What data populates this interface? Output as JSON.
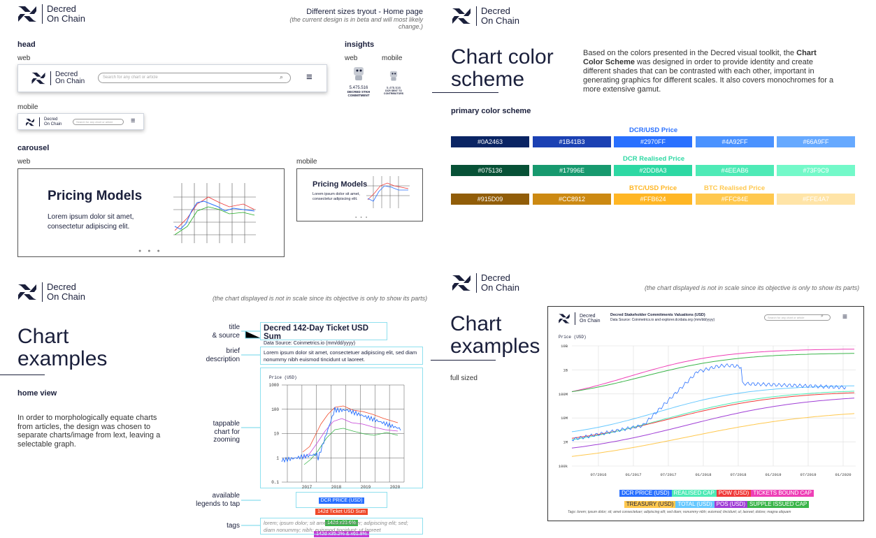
{
  "logo": {
    "line1": "Decred",
    "line2": "On Chain"
  },
  "page_title": "Different sizes tryout  - Home page",
  "page_subtitle": "(the current design is in beta and will most likely change.)",
  "head": {
    "label": "head",
    "web": "web",
    "mobile": "mobile",
    "search_placeholder": "Search for any chart or article"
  },
  "insights": {
    "label": "insights",
    "web": "web",
    "mobile": "mobile",
    "web_value": "5.475.516",
    "web_caption": "DECRED STKH COMMITMENT",
    "mobile_value": "5.475.516",
    "mobile_caption": "DCR SENT TO CONTRIBUTORS"
  },
  "carousel": {
    "label": "carousel",
    "web": "web",
    "mobile": "mobile",
    "title": "Pricing Models",
    "body": "Lorem ipsum dolor sit amet, consectetur adipiscing elit.",
    "title_m": "Pricing Models",
    "body_m": "Lorem ipsum dolor sit amet, consectetur adipiscing elit."
  },
  "color": {
    "title1": "Chart color",
    "title2": "scheme",
    "desc_pre": "Based on the colors presented in the Decred visual toolkit, the ",
    "desc_bold": "Chart Color Scheme",
    "desc_post": " was designed in order to provide identity and create different shades that can be contrasted with each other, important in generating graphics for different scales. It also covers monochromes for a more extensive gamut.",
    "primary": "primary color scheme",
    "labels": {
      "dcrusd": "DCR/USD Price",
      "realised": "DCR Realised Price",
      "btcusd": "BTC/USD Price",
      "btcreal": "BTC Realised Price"
    },
    "row1": [
      "#0A2463",
      "#1B41B3",
      "#2970FF",
      "#4A92FF",
      "#66A9FF"
    ],
    "row2": [
      "#075136",
      "#17996E",
      "#2DD8A3",
      "#4EEAB6",
      "#73F9C9"
    ],
    "row3": [
      "#915D09",
      "#CC8912",
      "#FFB624",
      "#FFC84E",
      "#FFE4A7"
    ],
    "row1_text": [
      "#0A2463",
      "#1B41B3",
      "#2970FF",
      "#4A92FF",
      "#66A9FF"
    ],
    "row2_text": [
      "#075136",
      "#17996E",
      "#2DD8A3",
      "#4EEAB6",
      "#73F9C9"
    ],
    "row3_text": [
      "#915D09",
      "#CC8912",
      "#FFB624",
      "#FFC84E",
      "#FFE4A7"
    ]
  },
  "examples": {
    "title1": "Chart",
    "title2": "examples",
    "home": "home view",
    "home_desc": "In order to morphologically equate charts from articles, the design was chosen to separate charts/image from lext, leaving a selectable graph.",
    "note": "(the chart displayed is not in scale since its objective is only to show its parts)",
    "anno_title": "title\n& source",
    "anno_brief": "brief\ndescription",
    "anno_tap": "tappable\nchart for\nzooming",
    "anno_legend": "available\nlegends to tap",
    "anno_tags": "tags",
    "chart_title": "Decred 142-Day Ticket USD Sum",
    "chart_source": "Data Source: Coinmetrics.io (mm/dd/yyyy)",
    "chart_desc": "Lorem ipsum dolor sit amet, consectetuer adipiscing elit, sed diam nonummy nibh euismod tincidunt ut laoreet.",
    "ylabel": "Price (USD)",
    "yticks": [
      "1000",
      "100",
      "10",
      "1",
      "0.1"
    ],
    "xticks": [
      "2017",
      "2018",
      "2019",
      "2020"
    ],
    "legend": [
      "DCR PRICE (USD)",
      "142d Ticket USD Sum",
      "142d x23.6%",
      "142d x35.2% & x61.8%"
    ],
    "tags": "lorem; ipsum dolor; sit amet; consectetuer; adipiscing elit; sed; diam nonummy; nibh; euismod tincidunt; ut laoreet"
  },
  "full": {
    "title1": "Chart",
    "title2": "examples",
    "label": "full sized",
    "note": "(the chart displayed is not in scale since its objective is only to show its parts)",
    "chart_title": "Decred Stakeholder Commitments Valuations (USD)",
    "chart_source": "Data Source: Coinmetrics.io and explorer.dcrdata.org (mm/dd/yyyy)",
    "search": "Search for any chart or article",
    "ylabel": "Price (USD)",
    "yticks": [
      "10B",
      "1B",
      "100M",
      "10M",
      "1M",
      "100k"
    ],
    "xticks": [
      "07/2016",
      "01/2017",
      "07/2017",
      "01/2018",
      "07/2018",
      "01/2019",
      "07/2019",
      "01/2020"
    ],
    "legend1": [
      "DCR PRICE (USD)",
      "REALISED CAP",
      "POW (USD)",
      "TICKETS BOUND CAP"
    ],
    "legend2": [
      "TREASURY (USD)",
      "TOTAL (USD)",
      "POS (USD)",
      "SUPPLE ISSUED CAP"
    ],
    "tags": "Tags: lorem; ipsum dolor; sit; amet consectetuer; adipiscing elit; sed diam; nonummy nibh; euismod; tincidunt; ut; laoreet; dolore; magna aliquam"
  }
}
